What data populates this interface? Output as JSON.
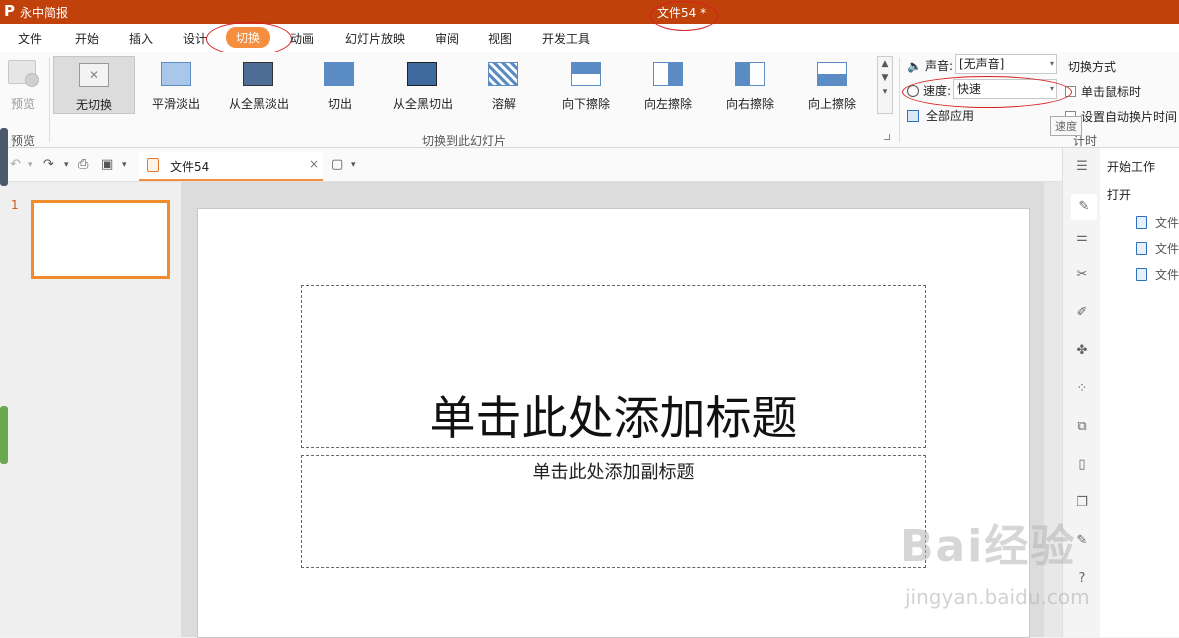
{
  "app": {
    "name": "永中简报",
    "doc_title": "文件54 *"
  },
  "menu": [
    "文件",
    "开始",
    "插入",
    "设计",
    "切换",
    "动画",
    "幻灯片放映",
    "审阅",
    "视图",
    "开发工具"
  ],
  "menu_active": "切换",
  "ribbon": {
    "preview_label": "预览",
    "preview_group_label": "预览",
    "effects": [
      "无切换",
      "平滑淡出",
      "从全黑淡出",
      "切出",
      "从全黑切出",
      "溶解",
      "向下擦除",
      "向左擦除",
      "向右擦除",
      "向上擦除"
    ],
    "selected_effect": "无切换",
    "transition_group_label": "切换到此幻灯片",
    "sound_label": "声音:",
    "sound_value": "[无声音]",
    "speed_label": "速度:",
    "speed_value": "快速",
    "apply_all_label": "全部应用",
    "switch_mode_label": "切换方式",
    "on_click_label": "单击鼠标时",
    "auto_advance_label": "设置自动换片时间",
    "timing_group_label": "计时",
    "tooltip": "速度"
  },
  "doc_tabs": [
    {
      "name": "文件54"
    }
  ],
  "slides": [
    {
      "number": "1"
    }
  ],
  "slide": {
    "title_placeholder": "单击此处添加标题",
    "subtitle_placeholder": "单击此处添加副标题"
  },
  "taskpane": {
    "title": "开始工作",
    "open_label": "打开",
    "files": [
      "文件",
      "文件",
      "文件"
    ]
  },
  "watermark": {
    "brand": "Bai经验",
    "url": "jingyan.baidu.com"
  },
  "colors": {
    "titlebar": "#c0410a",
    "accent": "#f58e3f",
    "annotation": "#d62020"
  }
}
